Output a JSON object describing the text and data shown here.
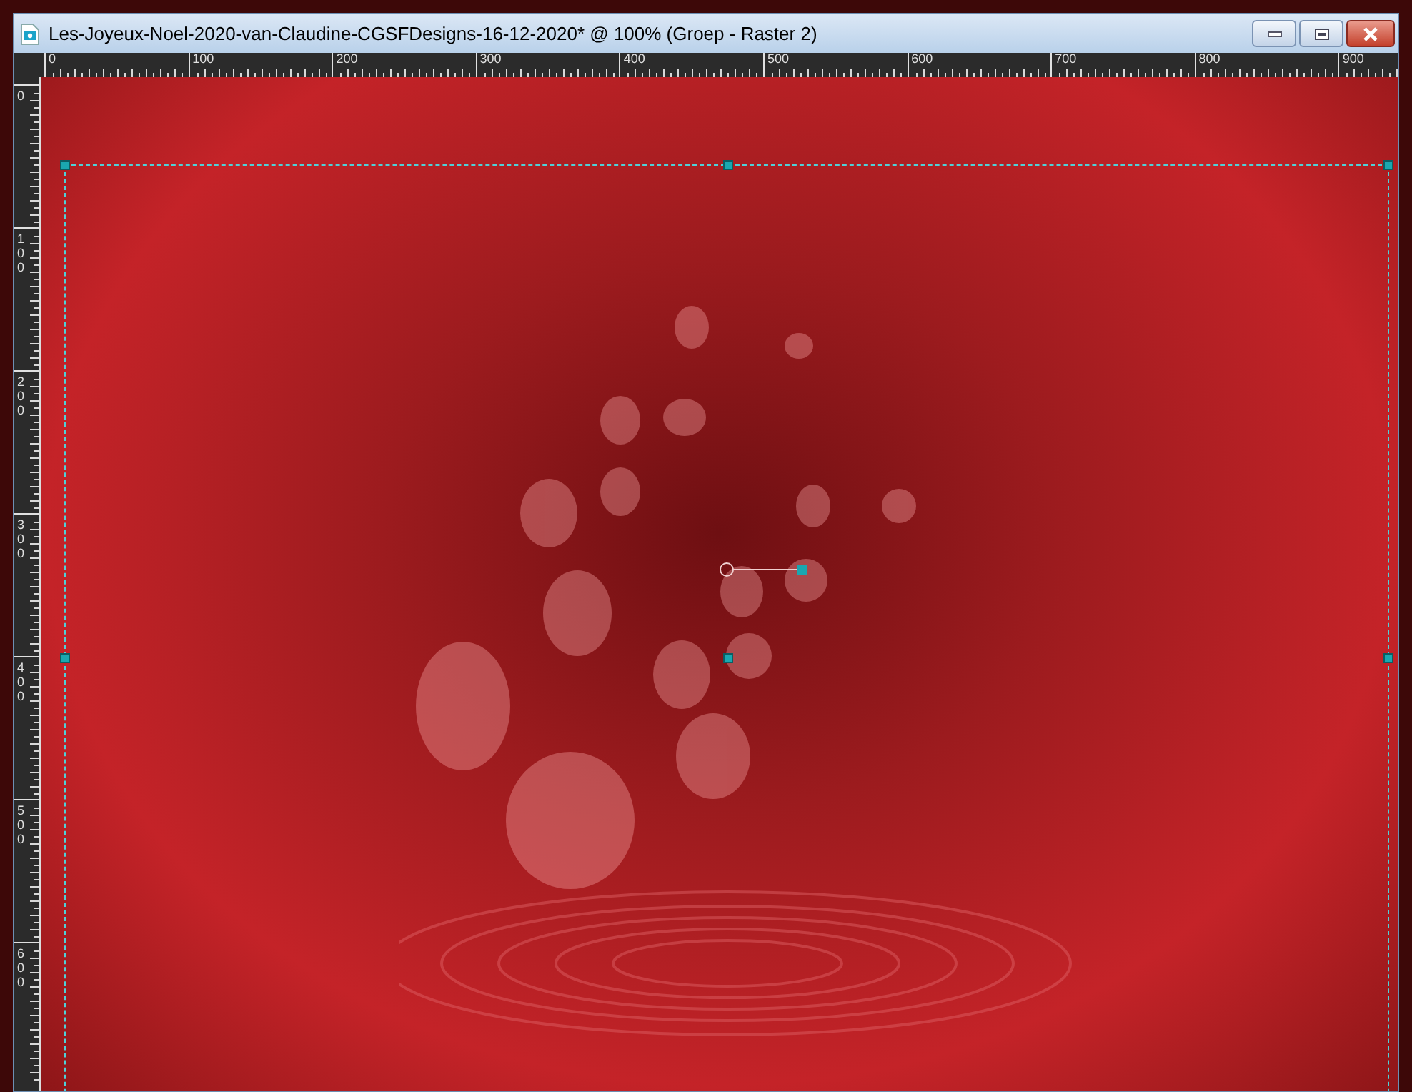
{
  "window": {
    "title": "Les-Joyeux-Noel-2020-van-Claudine-CGSFDesigns-16-12-2020* @ 100% (Groep - Raster 2)"
  },
  "rulers": {
    "horizontal": [
      "0",
      "100",
      "200",
      "300",
      "400",
      "500",
      "600",
      "700",
      "800",
      "900"
    ],
    "vertical": [
      "0",
      "100",
      "200",
      "300",
      "400",
      "500",
      "600"
    ]
  }
}
